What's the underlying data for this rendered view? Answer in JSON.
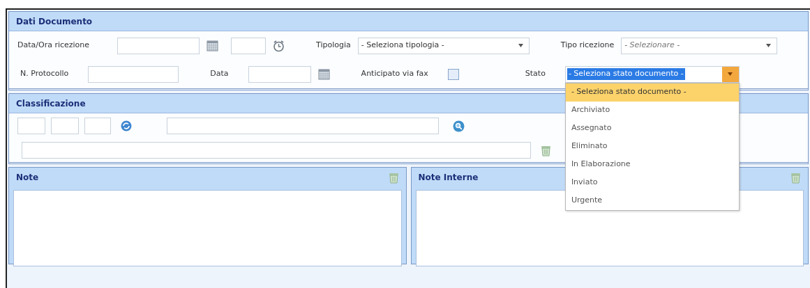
{
  "dati_documento": {
    "title": "Dati Documento",
    "rows": [
      {
        "fields": [
          {
            "label": "Data/Ora ricezione",
            "kind": "datetime"
          },
          {
            "label": "Tipologia",
            "kind": "select",
            "value": "- Seleziona tipologia -"
          },
          {
            "label": "Tipo ricezione",
            "kind": "select",
            "placeholder": "- Selezionare -"
          }
        ]
      },
      {
        "fields": [
          {
            "label": "N. Protocollo",
            "kind": "text"
          },
          {
            "label": "Data",
            "kind": "date"
          },
          {
            "label": "Anticipato via fax",
            "kind": "checkbox",
            "checked": false
          },
          {
            "label": "Stato",
            "kind": "select",
            "value": "- Seleziona stato documento -",
            "focused": true,
            "expanded": true,
            "options": [
              {
                "label": "- Seleziona stato documento -",
                "selected": true
              },
              {
                "label": "Archiviato",
                "selected": false
              },
              {
                "label": "Assegnato",
                "selected": false
              },
              {
                "label": "Eliminato",
                "selected": false
              },
              {
                "label": "In Elaborazione",
                "selected": false
              },
              {
                "label": "Inviato",
                "selected": false
              },
              {
                "label": "Urgente",
                "selected": false
              }
            ]
          }
        ]
      }
    ]
  },
  "classificazione": {
    "title": "Classificazione"
  },
  "note": [
    {
      "title": "Note"
    },
    {
      "title": "Note Interne"
    }
  ]
}
